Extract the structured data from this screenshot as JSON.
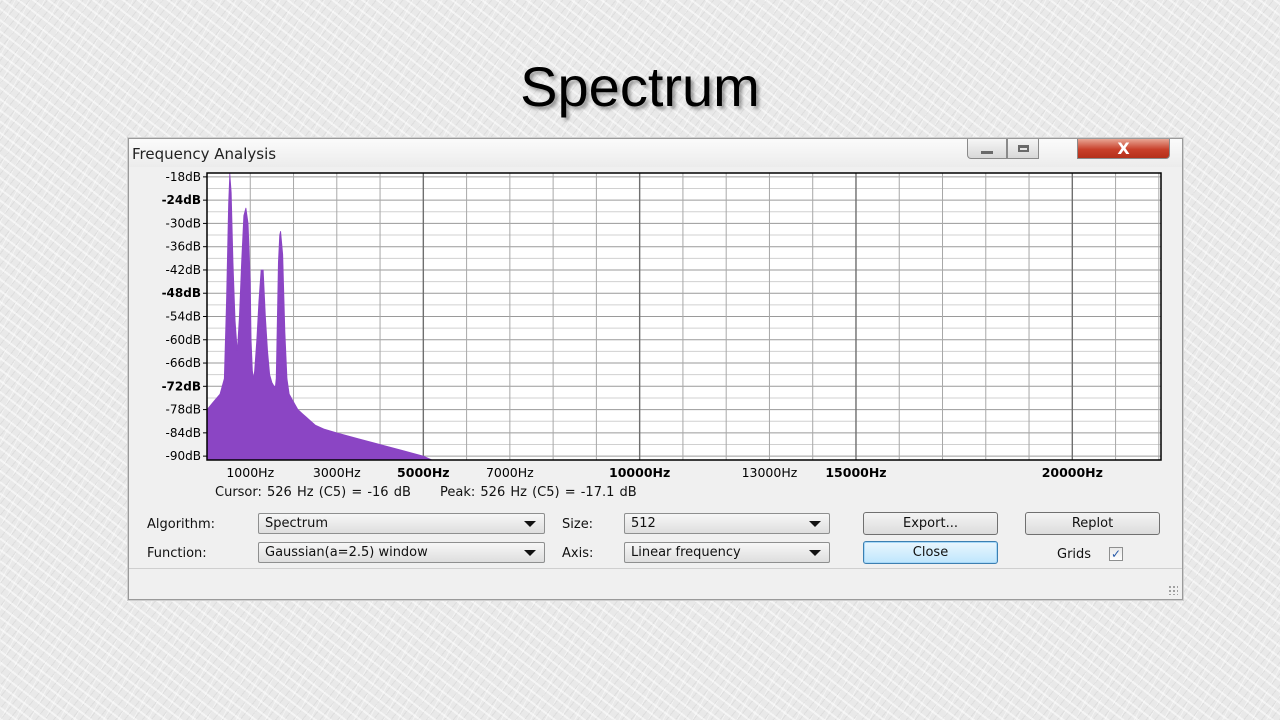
{
  "slide": {
    "title": "Spectrum"
  },
  "window": {
    "title": "Frequency Analysis",
    "controls": {
      "minimize_icon": "minimize-icon",
      "maximize_icon": "maximize-icon",
      "close_icon": "close-icon",
      "close_glyph": "X"
    }
  },
  "plot": {
    "fill_color": "#8b45c4",
    "y_ticks": [
      "-18dB",
      "-24dB",
      "-30dB",
      "-36dB",
      "-42dB",
      "-48dB",
      "-54dB",
      "-60dB",
      "-66dB",
      "-72dB",
      "-78dB",
      "-84dB",
      "-90dB"
    ],
    "x_ticks": [
      {
        "label": "1000Hz",
        "value": 1000,
        "bold": false
      },
      {
        "label": "3000Hz",
        "value": 3000,
        "bold": false
      },
      {
        "label": "5000Hz",
        "value": 5000,
        "bold": true
      },
      {
        "label": "7000Hz",
        "value": 7000,
        "bold": false
      },
      {
        "label": "10000Hz",
        "value": 10000,
        "bold": true
      },
      {
        "label": "13000Hz",
        "value": 13000,
        "bold": false
      },
      {
        "label": "15000Hz",
        "value": 15000,
        "bold": true
      },
      {
        "label": "20000Hz",
        "value": 20000,
        "bold": true
      }
    ]
  },
  "chart_data": {
    "type": "area",
    "xlabel": "",
    "ylabel": "",
    "xlim": [
      0,
      22050
    ],
    "ylim": [
      -91,
      -17
    ],
    "grid": true,
    "x": [
      0,
      150,
      300,
      400,
      450,
      500,
      526,
      560,
      600,
      650,
      700,
      750,
      800,
      850,
      900,
      950,
      1000,
      1020,
      1050,
      1080,
      1100,
      1150,
      1200,
      1250,
      1300,
      1350,
      1400,
      1450,
      1500,
      1550,
      1580,
      1600,
      1620,
      1650,
      1680,
      1700,
      1750,
      1800,
      1850,
      1900,
      2000,
      2100,
      2200,
      2300,
      2400,
      2500,
      2700,
      3000,
      3500,
      4000,
      4500,
      5000,
      5200
    ],
    "series": [
      {
        "values": [
          -78,
          -76,
          -74,
          -70,
          -50,
          -25,
          -17.1,
          -22,
          -40,
          -55,
          -63,
          -54,
          -40,
          -28,
          -26,
          -30,
          -45,
          -60,
          -68,
          -70,
          -68,
          -60,
          -50,
          -42,
          -42,
          -54,
          -63,
          -69,
          -71,
          -72,
          -72,
          -70,
          -58,
          -40,
          -33,
          -32,
          -38,
          -58,
          -70,
          -74,
          -76,
          -78,
          -79,
          -80,
          -81,
          -82,
          -83,
          -84,
          -85.5,
          -87,
          -88.5,
          -90,
          -91
        ]
      }
    ]
  },
  "status": {
    "cursor": "Cursor: 526 Hz (C5) = -16 dB",
    "peak": "Peak: 526 Hz (C5) = -17.1 dB"
  },
  "controls": {
    "algorithm_label": "Algorithm:",
    "algorithm_value": "Spectrum",
    "size_label": "Size:",
    "size_value": "512",
    "export_label": "Export...",
    "replot_label": "Replot",
    "function_label": "Function:",
    "function_value": "Gaussian(a=2.5) window",
    "axis_label": "Axis:",
    "axis_value": "Linear frequency",
    "close_label": "Close",
    "grids_label": "Grids",
    "grids_checked": true,
    "check_glyph": "✓"
  }
}
